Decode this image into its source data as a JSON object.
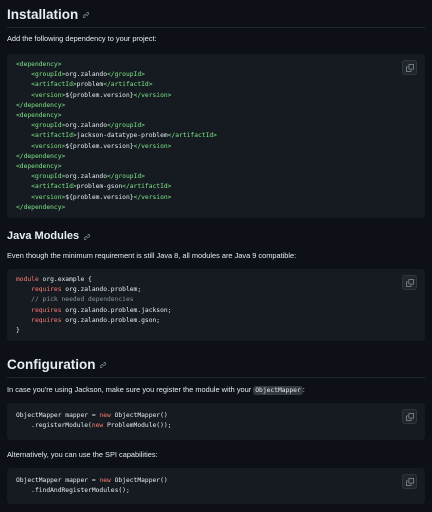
{
  "sections": {
    "installation": {
      "title": "Installation",
      "intro": "Add the following dependency to your project:",
      "code": [
        [
          {
            "c": "tag",
            "t": "<dependency>"
          }
        ],
        [
          {
            "c": "pl",
            "t": "    "
          },
          {
            "c": "tag",
            "t": "<groupId>"
          },
          {
            "c": "pl",
            "t": "org.zalando"
          },
          {
            "c": "tag",
            "t": "</groupId>"
          }
        ],
        [
          {
            "c": "pl",
            "t": "    "
          },
          {
            "c": "tag",
            "t": "<artifactId>"
          },
          {
            "c": "pl",
            "t": "problem"
          },
          {
            "c": "tag",
            "t": "</artifactId>"
          }
        ],
        [
          {
            "c": "pl",
            "t": "    "
          },
          {
            "c": "tag",
            "t": "<version>"
          },
          {
            "c": "pl",
            "t": "${problem.version}"
          },
          {
            "c": "tag",
            "t": "</version>"
          }
        ],
        [
          {
            "c": "tag",
            "t": "</dependency>"
          }
        ],
        [
          {
            "c": "tag",
            "t": "<dependency>"
          }
        ],
        [
          {
            "c": "pl",
            "t": "    "
          },
          {
            "c": "tag",
            "t": "<groupId>"
          },
          {
            "c": "pl",
            "t": "org.zalando"
          },
          {
            "c": "tag",
            "t": "</groupId>"
          }
        ],
        [
          {
            "c": "pl",
            "t": "    "
          },
          {
            "c": "tag",
            "t": "<artifactId>"
          },
          {
            "c": "pl",
            "t": "jackson-datatype-problem"
          },
          {
            "c": "tag",
            "t": "</artifactId>"
          }
        ],
        [
          {
            "c": "pl",
            "t": "    "
          },
          {
            "c": "tag",
            "t": "<version>"
          },
          {
            "c": "pl",
            "t": "${problem.version}"
          },
          {
            "c": "tag",
            "t": "</version>"
          }
        ],
        [
          {
            "c": "tag",
            "t": "</dependency>"
          }
        ],
        [
          {
            "c": "tag",
            "t": "<dependency>"
          }
        ],
        [
          {
            "c": "pl",
            "t": "    "
          },
          {
            "c": "tag",
            "t": "<groupId>"
          },
          {
            "c": "pl",
            "t": "org.zalando"
          },
          {
            "c": "tag",
            "t": "</groupId>"
          }
        ],
        [
          {
            "c": "pl",
            "t": "    "
          },
          {
            "c": "tag",
            "t": "<artifactId>"
          },
          {
            "c": "pl",
            "t": "problem-gson"
          },
          {
            "c": "tag",
            "t": "</artifactId>"
          }
        ],
        [
          {
            "c": "pl",
            "t": "    "
          },
          {
            "c": "tag",
            "t": "<version>"
          },
          {
            "c": "pl",
            "t": "${problem.version}"
          },
          {
            "c": "tag",
            "t": "</version>"
          }
        ],
        [
          {
            "c": "tag",
            "t": "</dependency>"
          }
        ]
      ]
    },
    "java_modules": {
      "title": "Java Modules",
      "intro": "Even though the minimum requirement is still Java 8, all modules are Java 9 compatible:",
      "code": [
        [
          {
            "c": "kw",
            "t": "module"
          },
          {
            "c": "pl",
            "t": " org.example {"
          }
        ],
        [
          {
            "c": "pl",
            "t": "    "
          },
          {
            "c": "kw",
            "t": "requires"
          },
          {
            "c": "pl",
            "t": " org.zalando.problem;"
          }
        ],
        [
          {
            "c": "pl",
            "t": "    "
          },
          {
            "c": "cm",
            "t": "// pick needed dependencies"
          }
        ],
        [
          {
            "c": "pl",
            "t": "    "
          },
          {
            "c": "kw",
            "t": "requires"
          },
          {
            "c": "pl",
            "t": " org.zalando.problem.jackson;"
          }
        ],
        [
          {
            "c": "pl",
            "t": "    "
          },
          {
            "c": "kw",
            "t": "requires"
          },
          {
            "c": "pl",
            "t": " org.zalando.problem.gson;"
          }
        ],
        [
          {
            "c": "pl",
            "t": "}"
          }
        ]
      ]
    },
    "configuration": {
      "title": "Configuration",
      "intro_before": "In case you're using Jackson, make sure you register the module with your ",
      "intro_code": "ObjectMapper",
      "intro_after": ":",
      "code1": [
        [
          {
            "c": "pl",
            "t": "ObjectMapper mapper = "
          },
          {
            "c": "kw",
            "t": "new"
          },
          {
            "c": "pl",
            "t": " ObjectMapper()"
          }
        ],
        [
          {
            "c": "pl",
            "t": "    .registerModule("
          },
          {
            "c": "kw",
            "t": "new"
          },
          {
            "c": "pl",
            "t": " ProblemModule());"
          }
        ]
      ],
      "alt_text": "Alternatively, you can use the SPI capabilities:",
      "code2": [
        [
          {
            "c": "pl",
            "t": "ObjectMapper mapper = "
          },
          {
            "c": "kw",
            "t": "new"
          },
          {
            "c": "pl",
            "t": " ObjectMapper()"
          }
        ],
        [
          {
            "c": "pl",
            "t": "    .findAndRegisterModules();"
          }
        ]
      ]
    }
  },
  "icons": {
    "heading_anchor": "link-icon",
    "copy": "copy-icon"
  },
  "colors": {
    "background": "#0d1117",
    "code_background": "#161b22",
    "tag": "#7ee787",
    "keyword": "#ff7b72",
    "comment": "#8b949e",
    "text": "#e6edf3"
  }
}
